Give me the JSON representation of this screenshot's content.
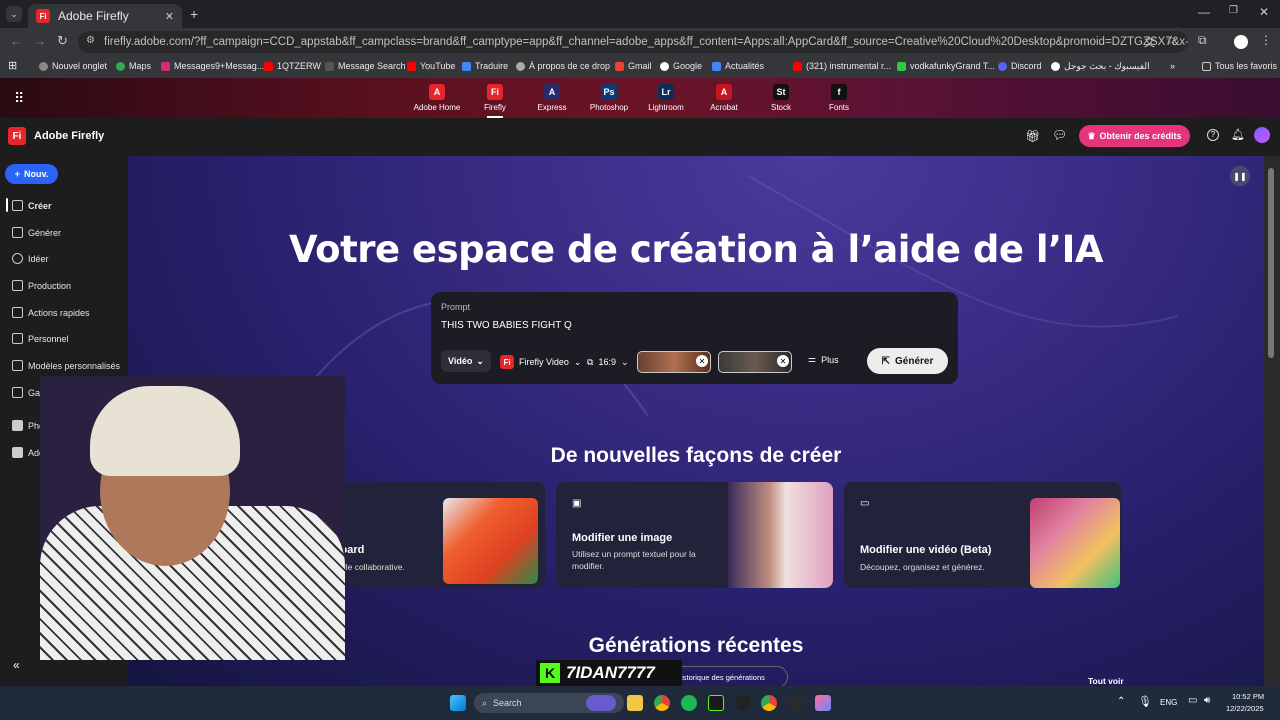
{
  "browser": {
    "tab_title": "Adobe Firefly",
    "url": "firefly.adobe.com/?ff_campaign=CCD_appstab&ff_campclass=brand&ff_camptype=app&ff_channel=adobe_apps&ff_content=Apps:all:AppCard&ff_source=Creative%20Cloud%20Desktop&promoid=DZTGZSX7&x-product=Creative%20Cloud%20Des...",
    "bookmarks": [
      "Nouvel onglet",
      "Maps",
      "Messages9+Messag...",
      "1QTZERW",
      "Message Search",
      "YouTube",
      "Traduire",
      "À propos de ce drop",
      "Gmail",
      "Google",
      "Actualités",
      "(321) instrumental r...",
      "vodkafunkyGrand T...",
      "Discord",
      "الفيسبوك - بحث جوجل"
    ],
    "all_bookmarks": "Tous les favoris"
  },
  "apps": [
    {
      "label": "Adobe Home",
      "abbr": "A",
      "color": "#e5262b"
    },
    {
      "label": "Firefly",
      "abbr": "Fi",
      "color": "#e5262b"
    },
    {
      "label": "Express",
      "abbr": "A",
      "color": "#2b2b6b"
    },
    {
      "label": "Photoshop",
      "abbr": "Ps",
      "color": "#0b3b74"
    },
    {
      "label": "Lightroom",
      "abbr": "Lr",
      "color": "#0b2d5a"
    },
    {
      "label": "Acrobat",
      "abbr": "A",
      "color": "#c4161c"
    },
    {
      "label": "Stock",
      "abbr": "St",
      "color": "#111111"
    },
    {
      "label": "Fonts",
      "abbr": "f",
      "color": "#111111"
    }
  ],
  "header": {
    "app_name": "Adobe Firefly",
    "credits_button": "Obtenir des crédits"
  },
  "sidebar": {
    "new_button": "Nouv.",
    "items": [
      "Créer",
      "Générer",
      "Idéer",
      "Production",
      "Actions rapides",
      "Personnel",
      "Modèles personnalisés",
      "Galerie"
    ],
    "apps": [
      "Photoshop",
      "Adobe Express"
    ]
  },
  "hero": {
    "title": "Votre espace de création à l’aide de l’IA",
    "prompt_label": "Prompt",
    "prompt_value": "THIS TWO BABIES FIGHT Q",
    "type_select": "Vidéo",
    "model_select": "Firefly Video",
    "ratio_select": "16:9",
    "more": "Plus",
    "generate": "Générer"
  },
  "new_ways": {
    "title": "De nouvelles façons de créer",
    "cards": [
      {
        "title": "n board",
        "desc": "visuelle collaborative."
      },
      {
        "title": "Modifier une image",
        "desc": "Utilisez un prompt textuel pour la modifier."
      },
      {
        "title": "Modifier une vidéo (Beta)",
        "desc": "Découpez, organisez et générez."
      }
    ]
  },
  "recent": {
    "title": "Générations récentes",
    "history": "istorique des générations",
    "see_all": "Tout voir"
  },
  "overlay": {
    "streamer_name": "7IDAN7777"
  },
  "taskbar": {
    "search": "Search",
    "lang": "ENG",
    "time": "10:52 PM",
    "date": "12/22/2025"
  },
  "colors": {
    "accent_pink": "#e6337a",
    "accent_blue": "#2a64f6"
  }
}
